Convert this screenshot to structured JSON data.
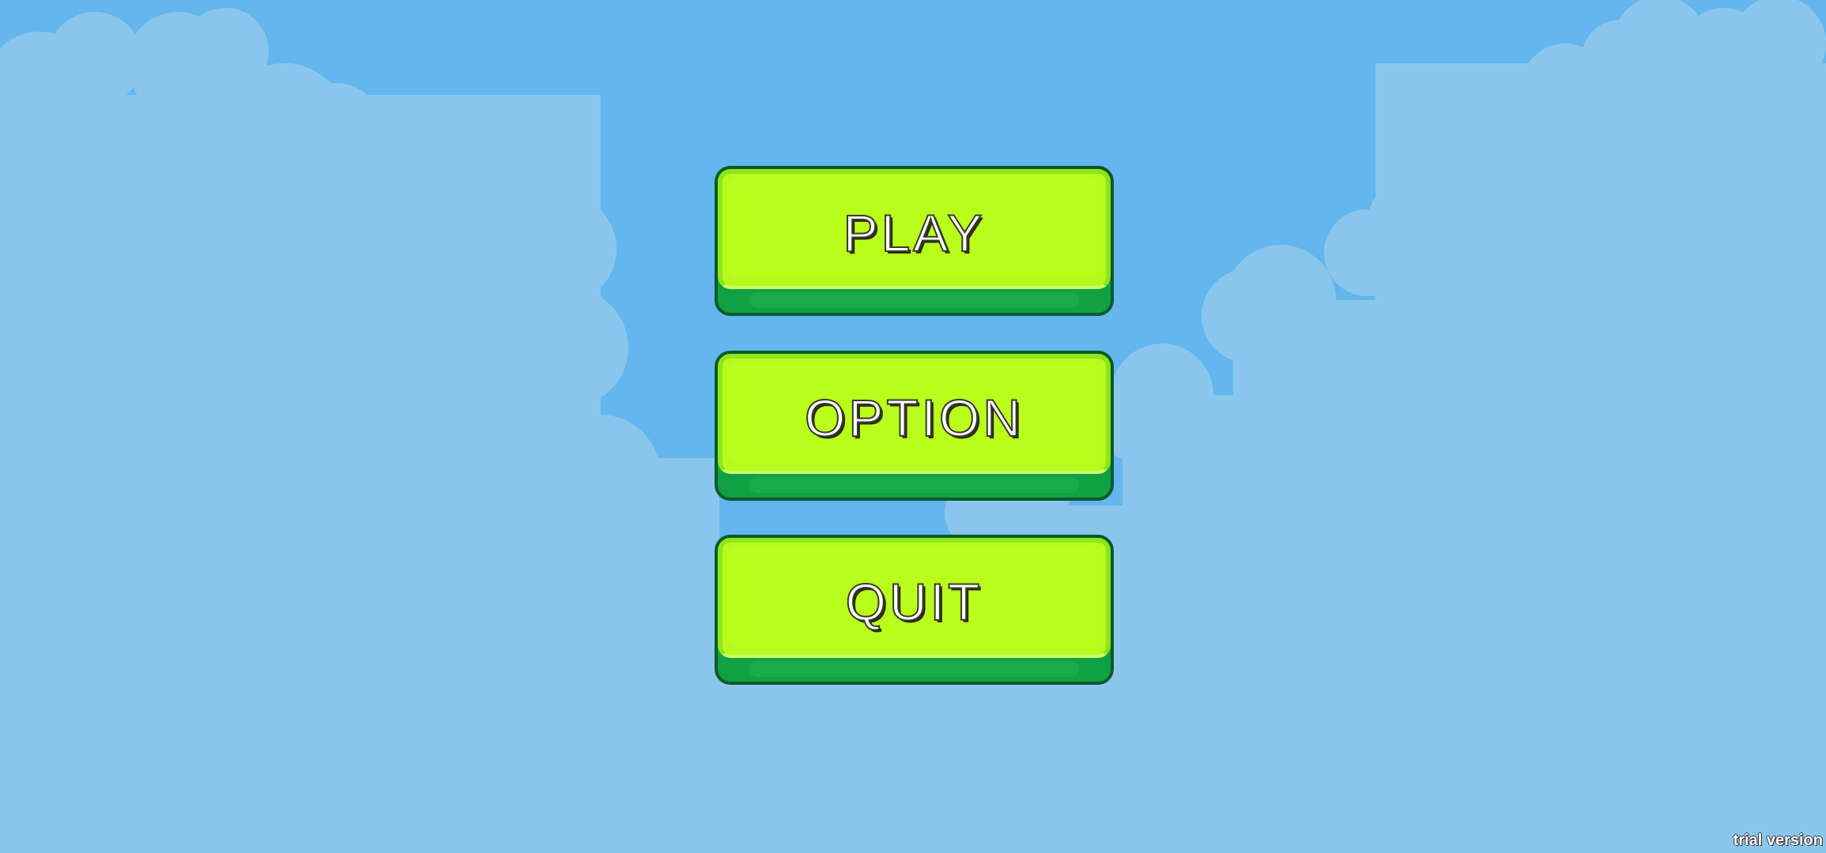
{
  "colors": {
    "sky": "#63b6ee",
    "cloud": "#8ac6ec",
    "button_face": "#b9ff1c",
    "button_edge": "#0b5a2a",
    "button_base": "#12a045",
    "label_text": "#ffffff"
  },
  "menu": {
    "play_label": "PLAY",
    "option_label": "OPTION",
    "quit_label": "QUIT"
  },
  "watermark": {
    "text": "trial version"
  }
}
